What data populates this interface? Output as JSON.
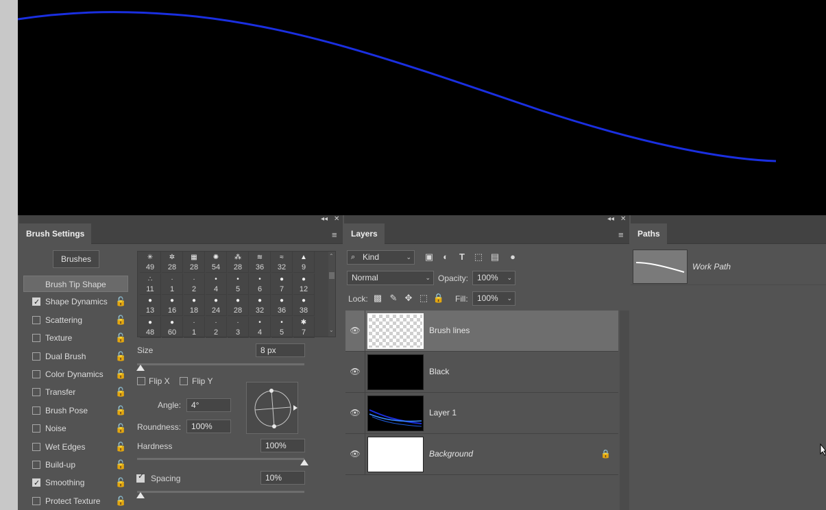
{
  "brush_settings": {
    "title": "Brush Settings",
    "collapse_glyph": "◂◂",
    "close_glyph": "✕",
    "menu_glyph": "≡",
    "brushes_button": "Brushes",
    "options": [
      {
        "label": "Brush Tip Shape",
        "checkbox": false,
        "checked": false,
        "active": true
      },
      {
        "label": "Shape Dynamics",
        "checkbox": true,
        "checked": true
      },
      {
        "label": "Scattering",
        "checkbox": true,
        "checked": false
      },
      {
        "label": "Texture",
        "checkbox": true,
        "checked": false
      },
      {
        "label": "Dual Brush",
        "checkbox": true,
        "checked": false
      },
      {
        "label": "Color Dynamics",
        "checkbox": true,
        "checked": false
      },
      {
        "label": "Transfer",
        "checkbox": true,
        "checked": false
      },
      {
        "label": "Brush Pose",
        "checkbox": true,
        "checked": false
      },
      {
        "label": "Noise",
        "checkbox": true,
        "checked": false
      },
      {
        "label": "Wet Edges",
        "checkbox": true,
        "checked": false
      },
      {
        "label": "Build-up",
        "checkbox": true,
        "checked": false
      },
      {
        "label": "Smoothing",
        "checkbox": true,
        "checked": true
      },
      {
        "label": "Protect Texture",
        "checkbox": true,
        "checked": false
      }
    ],
    "lock_glyph": "🔓",
    "presets": [
      {
        "glyph": "✳",
        "n": "49"
      },
      {
        "glyph": "✲",
        "n": "28"
      },
      {
        "glyph": "▦",
        "n": "28"
      },
      {
        "glyph": "✺",
        "n": "54"
      },
      {
        "glyph": "⁂",
        "n": "28"
      },
      {
        "glyph": "≋",
        "n": "36"
      },
      {
        "glyph": "≈",
        "n": "32"
      },
      {
        "glyph": "▲",
        "n": "9"
      },
      {
        "glyph": "∴",
        "n": "11"
      },
      {
        "glyph": "·",
        "n": "1"
      },
      {
        "glyph": "·",
        "n": "2"
      },
      {
        "glyph": "•",
        "n": "4"
      },
      {
        "glyph": "•",
        "n": "5"
      },
      {
        "glyph": "•",
        "n": "6"
      },
      {
        "glyph": "●",
        "n": "7"
      },
      {
        "glyph": "●",
        "n": "12"
      },
      {
        "glyph": "●",
        "n": "13"
      },
      {
        "glyph": "●",
        "n": "16"
      },
      {
        "glyph": "●",
        "n": "18"
      },
      {
        "glyph": "●",
        "n": "24"
      },
      {
        "glyph": "●",
        "n": "28"
      },
      {
        "glyph": "●",
        "n": "32"
      },
      {
        "glyph": "●",
        "n": "36"
      },
      {
        "glyph": "●",
        "n": "38"
      },
      {
        "glyph": "●",
        "n": "48"
      },
      {
        "glyph": "●",
        "n": "60"
      },
      {
        "glyph": "·",
        "n": "1"
      },
      {
        "glyph": "·",
        "n": "2"
      },
      {
        "glyph": "·",
        "n": "3"
      },
      {
        "glyph": "•",
        "n": "4"
      },
      {
        "glyph": "•",
        "n": "5"
      },
      {
        "glyph": "✱",
        "n": "7"
      }
    ],
    "size_label": "Size",
    "size_value": "8 px",
    "size_fraction": 0.02,
    "flip_x_label": "Flip X",
    "flip_y_label": "Flip Y",
    "angle_label": "Angle:",
    "angle_value": "4°",
    "roundness_label": "Roundness:",
    "roundness_value": "100%",
    "hardness_label": "Hardness",
    "hardness_value": "100%",
    "hardness_fraction": 1.0,
    "spacing_label": "Spacing",
    "spacing_value": "10%",
    "spacing_checked": true,
    "spacing_fraction": 0.02
  },
  "layers": {
    "title": "Layers",
    "collapse_glyph": "◂◂",
    "close_glyph": "✕",
    "menu_glyph": "≡",
    "kind_label": "Kind",
    "blend_mode": "Normal",
    "opacity_label": "Opacity:",
    "opacity_value": "100%",
    "lock_label": "Lock:",
    "fill_label": "Fill:",
    "fill_value": "100%",
    "filter_icons": [
      "image-filter-icon",
      "adjustment-filter-icon",
      "type-filter-icon",
      "shape-filter-icon",
      "smart-object-filter-icon",
      "filter-toggle-icon"
    ],
    "lock_icons": [
      "lock-transparent-icon",
      "lock-image-icon",
      "lock-position-icon",
      "lock-artboard-icon",
      "lock-all-icon"
    ],
    "items": [
      {
        "name": "Brush lines",
        "thumb": "transparent",
        "selected": true,
        "italic": false,
        "locked": false
      },
      {
        "name": "Black",
        "thumb": "black",
        "selected": false,
        "italic": false,
        "locked": false
      },
      {
        "name": "Layer 1",
        "thumb": "blue-lines",
        "selected": false,
        "italic": false,
        "locked": false
      },
      {
        "name": "Background",
        "thumb": "white",
        "selected": false,
        "italic": true,
        "locked": true
      }
    ]
  },
  "paths": {
    "title": "Paths",
    "items": [
      {
        "name": "Work Path"
      }
    ]
  },
  "colors": {
    "stroke": "#1a2fe0",
    "panel": "#535353",
    "panel_dark": "#424242"
  }
}
